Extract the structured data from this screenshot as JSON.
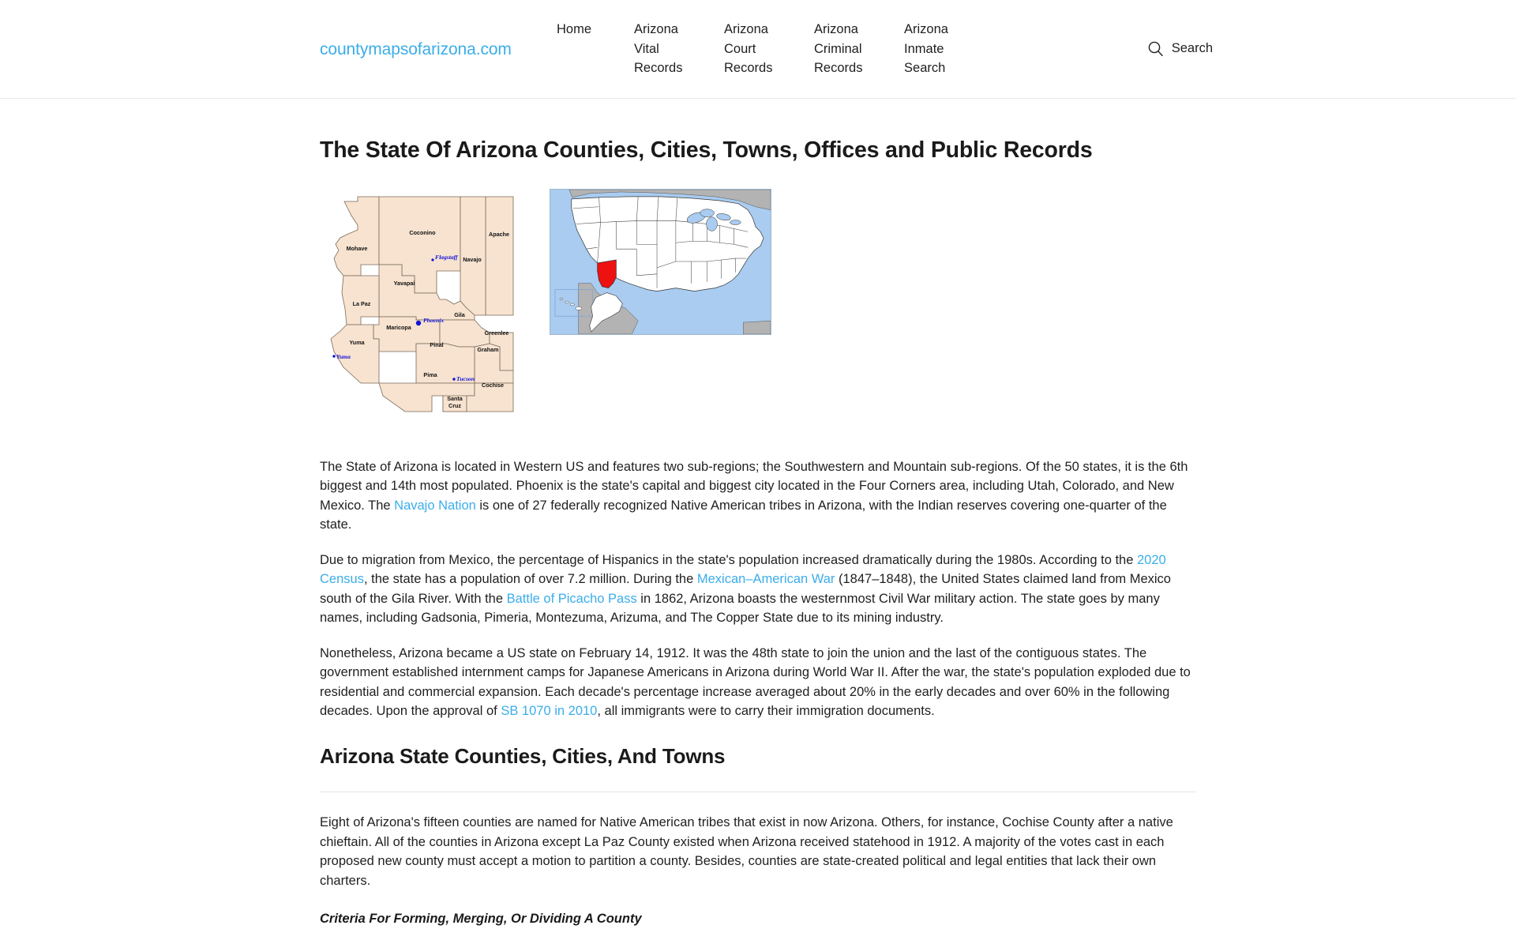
{
  "header": {
    "brand": "countymapsofarizona.com",
    "nav": [
      {
        "label": "Home",
        "name": "nav-home"
      },
      {
        "label": "Arizona Vital Records",
        "name": "nav-arizona-vital-records"
      },
      {
        "label": "Arizona Court Records",
        "name": "nav-arizona-court-records"
      },
      {
        "label": "Arizona Criminal Records",
        "name": "nav-arizona-criminal-records"
      },
      {
        "label": "Arizona Inmate Search",
        "name": "nav-arizona-inmate-search"
      }
    ],
    "search": {
      "icon": "search-icon",
      "label": "Search"
    }
  },
  "main": {
    "page_title": "The State Of Arizona Counties, Cities, Towns, Offices and Public Records",
    "maps": {
      "arizona_county_map": {
        "alt": "Map of Arizona counties",
        "counties": [
          "Mohave",
          "Coconino",
          "Apache",
          "Navajo",
          "Yavapai",
          "La Paz",
          "Maricopa",
          "Gila",
          "Greenlee",
          "Graham",
          "Yuma",
          "Pinal",
          "Pima",
          "Cochise",
          "Santa Cruz"
        ],
        "cities": [
          "Flagstaff",
          "Phoenix",
          "Tucson",
          "Yuma"
        ],
        "fill_color": "#f7e3d0",
        "city_color": "#1313d8"
      },
      "us_locator_map": {
        "alt": "United States map with Arizona highlighted in red",
        "highlight_color": "#ee1111",
        "ocean_color": "#a9ccf0",
        "land_color": "#ffffff",
        "foreign_color": "#b3b3b3"
      }
    },
    "paragraphs": [
      {
        "name": "paragraph-overview",
        "parts": [
          {
            "t": "The State of Arizona is located in Western US and features two sub-regions; the Southwestern and Mountain sub-regions. Of the 50 states, it is the 6th biggest and 14th most populated. Phoenix is the state's capital and biggest city located in the Four Corners area, including Utah, Colorado, and New Mexico. The "
          },
          {
            "t": "Navajo Nation",
            "link": true
          },
          {
            "t": " is one of 27 federally recognized Native American tribes in Arizona, with the Indian reserves covering one-quarter of the state."
          }
        ]
      },
      {
        "name": "paragraph-history-migration",
        "parts": [
          {
            "t": "Due to migration from Mexico, the percentage of Hispanics in the state's population increased dramatically during the 1980s. According to the "
          },
          {
            "t": "2020 Census",
            "link": true
          },
          {
            "t": ", the state has a population of over 7.2 million. During the "
          },
          {
            "t": "Mexican–American War",
            "link": true
          },
          {
            "t": " (1847–1848), the United States claimed land from Mexico south of the Gila River. With the "
          },
          {
            "t": "Battle of Picacho Pass",
            "link": true
          },
          {
            "t": " in 1862, Arizona boasts the westernmost Civil War military action. The state goes by many names, including Gadsonia, Pimeria, Montezuma, Arizuma, and The Copper State due to its mining industry."
          }
        ]
      },
      {
        "name": "paragraph-statehood",
        "parts": [
          {
            "t": "Nonetheless, Arizona became a US state on February 14, 1912. It was the 48th state to join the union and the last of the contiguous states. The government established internment camps for Japanese Americans in Arizona during World War II. After the war, the state's population exploded due to residential and commercial expansion. Each decade's percentage increase averaged about 20% in the early decades and over 60% in the following decades. Upon the approval of "
          },
          {
            "t": "SB 1070 in 2010",
            "link": true
          },
          {
            "t": ", all immigrants were to carry their immigration documents."
          }
        ]
      }
    ],
    "section_title": "Arizona State Counties, Cities, And Towns",
    "section_paragraph": "Eight of Arizona's fifteen counties are named for Native American tribes that exist in now Arizona. Others, for instance, Cochise County after a native chieftain. All of the counties in Arizona except La Paz County existed when Arizona received statehood in 1912. A majority of the votes cast in each proposed new county must accept a motion to partition a county. Besides, counties are state-created political and legal entities that lack their own charters.",
    "subhead": "Criteria For Forming, Merging, Or Dividing A County"
  },
  "colors": {
    "accent": "#3badea",
    "text": "#1f1f1f",
    "heading": "#1a1a1a",
    "rule": "#e6e6e6"
  }
}
